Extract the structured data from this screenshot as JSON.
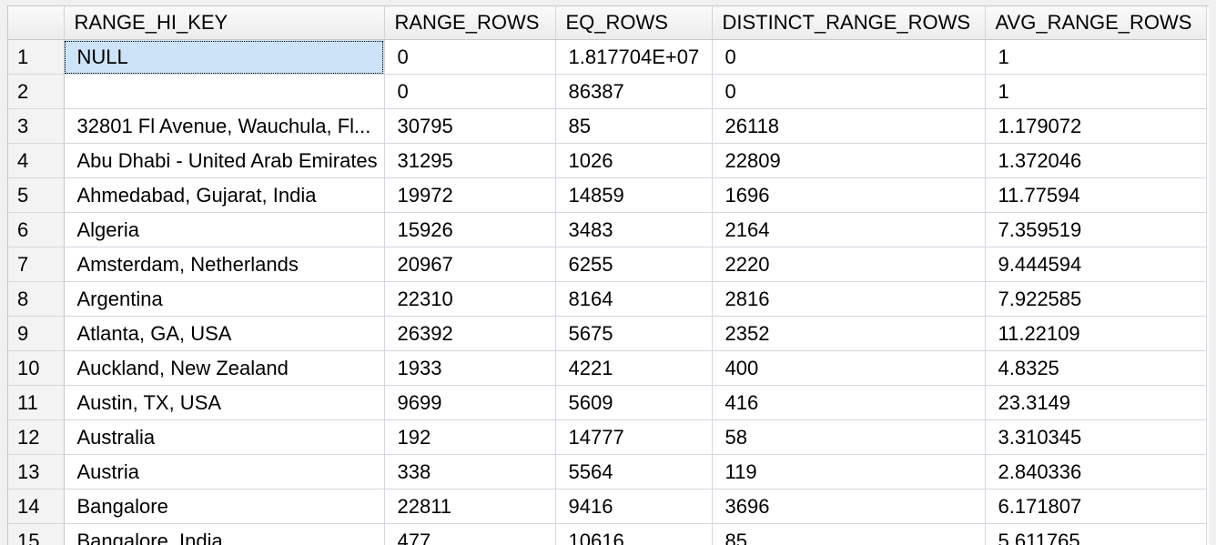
{
  "grid": {
    "columns": [
      "",
      "RANGE_HI_KEY",
      "RANGE_ROWS",
      "EQ_ROWS",
      "DISTINCT_RANGE_ROWS",
      "AVG_RANGE_ROWS"
    ],
    "rows": [
      [
        "1",
        "NULL",
        "0",
        "1.817704E+07",
        "0",
        "1"
      ],
      [
        "2",
        "",
        "0",
        "86387",
        "0",
        "1"
      ],
      [
        "3",
        "32801 Fl Avenue, Wauchula, Fl...",
        "30795",
        "85",
        "26118",
        "1.179072"
      ],
      [
        "4",
        "Abu Dhabi - United Arab Emirates",
        "31295",
        "1026",
        "22809",
        "1.372046"
      ],
      [
        "5",
        "Ahmedabad, Gujarat, India",
        "19972",
        "14859",
        "1696",
        "11.77594"
      ],
      [
        "6",
        "Algeria",
        "15926",
        "3483",
        "2164",
        "7.359519"
      ],
      [
        "7",
        "Amsterdam, Netherlands",
        "20967",
        "6255",
        "2220",
        "9.444594"
      ],
      [
        "8",
        "Argentina",
        "22310",
        "8164",
        "2816",
        "7.922585"
      ],
      [
        "9",
        "Atlanta, GA, USA",
        "26392",
        "5675",
        "2352",
        "11.22109"
      ],
      [
        "10",
        "Auckland, New Zealand",
        "1933",
        "4221",
        "400",
        "4.8325"
      ],
      [
        "11",
        "Austin, TX, USA",
        "9699",
        "5609",
        "416",
        "23.3149"
      ],
      [
        "12",
        "Australia",
        "192",
        "14777",
        "58",
        "3.310345"
      ],
      [
        "13",
        "Austria",
        "338",
        "5564",
        "119",
        "2.840336"
      ],
      [
        "14",
        "Bangalore",
        "22811",
        "9416",
        "3696",
        "6.171807"
      ],
      [
        "15",
        "Bangalore, India",
        "477",
        "10616",
        "85",
        "5.611765"
      ]
    ],
    "selected_cell": {
      "row": 0,
      "col": 1
    },
    "colors": {
      "selection": "#cce3f8",
      "header_bg": "#f3f3f3",
      "gridline": "#d6d6e0"
    }
  }
}
